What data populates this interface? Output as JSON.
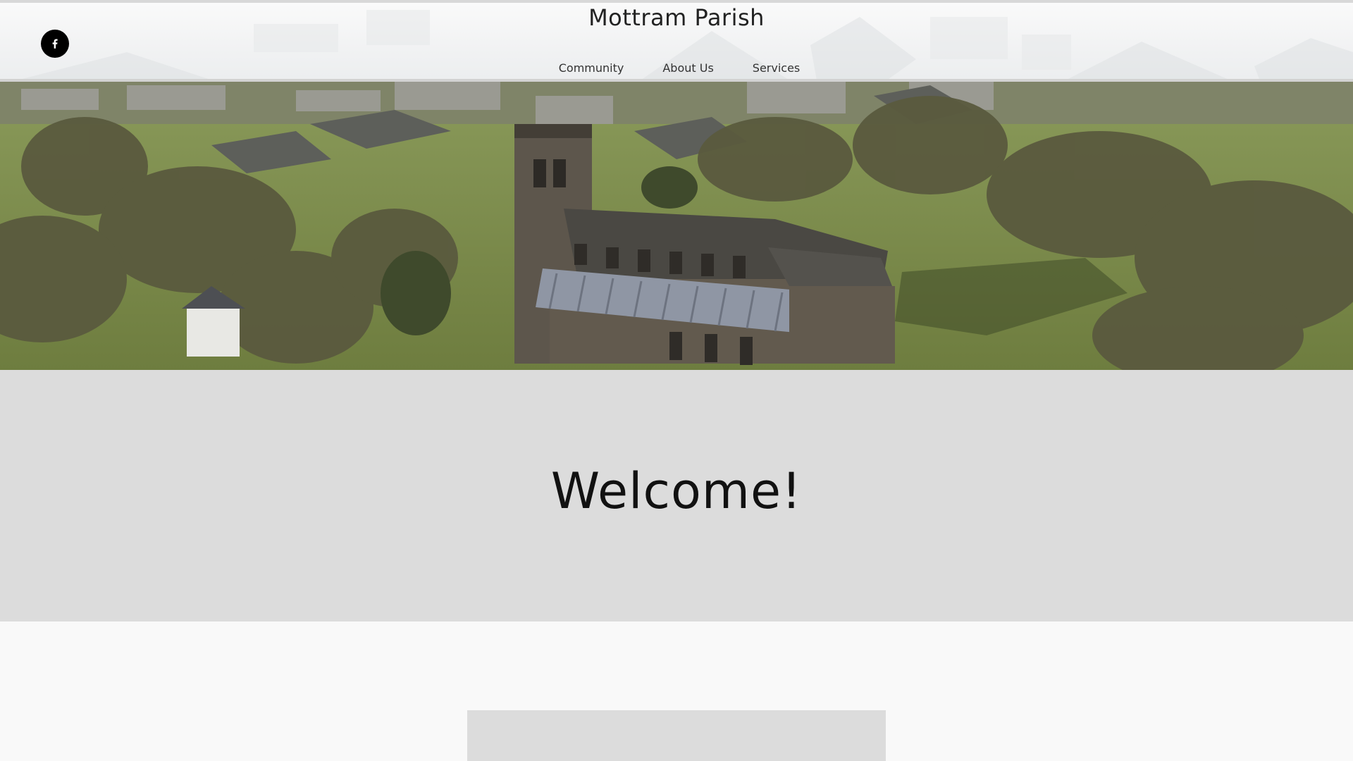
{
  "header": {
    "site_title": "Mottram Parish",
    "social": {
      "icon": "facebook-icon"
    },
    "nav": [
      {
        "label": "Community"
      },
      {
        "label": "About Us"
      },
      {
        "label": "Services"
      }
    ]
  },
  "hero": {
    "image": "aerial-church-photo"
  },
  "welcome": {
    "heading": "Welcome!"
  },
  "colors": {
    "header_bg": "#f1f2f3",
    "band_bg": "#dcdcdc",
    "page_bg": "#f9f9f9",
    "social_button": "#000000",
    "text": "#222222"
  }
}
